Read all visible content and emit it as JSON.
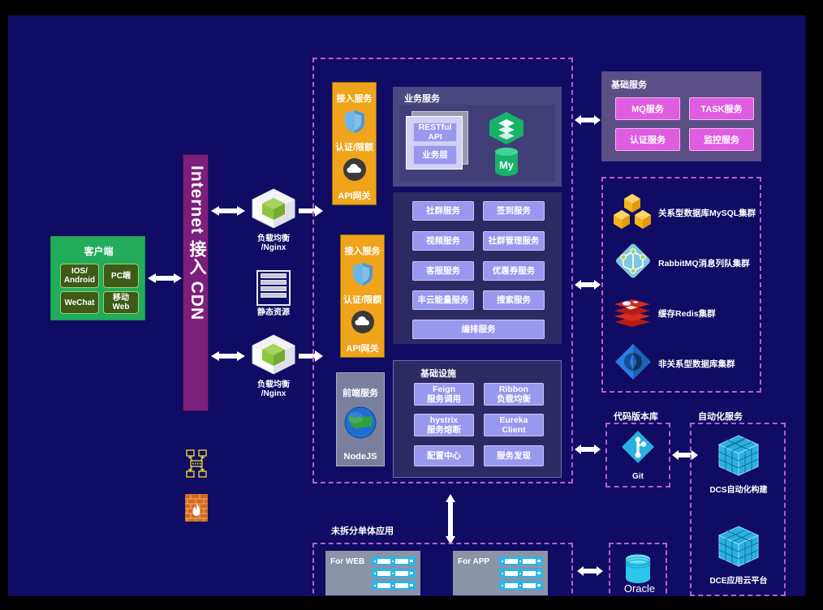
{
  "diagram": {
    "title": "Microservice Architecture Diagram",
    "background": "#100b63",
    "accent_dashed": "#b55fd0"
  },
  "client": {
    "title": "客户端",
    "chips": [
      "IOS/\nAndroid",
      "PC端",
      "WeChat",
      "移动\nWeb"
    ],
    "chip_ios": "IOS/",
    "chip_android": "Android",
    "chip_pc": "PC端",
    "chip_wechat": "WeChat",
    "chip_mweb1": "移动",
    "chip_mweb2": "Web"
  },
  "cdn": {
    "label": "Internet 接入 CDN",
    "network_icon": "network-topology-icon",
    "firewall_icon": "firewall-icon"
  },
  "edge": {
    "lb_top": {
      "line1": "负载均衡",
      "line2": "/Nginx",
      "icon": "cube-icon"
    },
    "lb_bottom": {
      "line1": "负载均衡",
      "line2": "/Nginx",
      "icon": "cube-icon"
    },
    "static": {
      "label": "静态资源",
      "icon": "static-resource-icon"
    }
  },
  "access_top": {
    "title": "接入服务",
    "auth_label": "认证/限额",
    "gateway_label": "API网关",
    "shield_icon": "shield-icon",
    "cloud_icon": "cloud-icon"
  },
  "access_bottom": {
    "title": "接入服务",
    "auth_label": "认证/限额",
    "gateway_label": "API网关",
    "shield_icon": "shield-icon",
    "cloud_icon": "cloud-icon"
  },
  "frontend": {
    "title": "前端服务",
    "name": "NodeJS",
    "icon": "globe-icon"
  },
  "business": {
    "title": "业务服务",
    "stack": {
      "restful": "RESTful\nAPI",
      "restful_l1": "RESTful",
      "restful_l2": "API",
      "biz_layer": "业务层"
    },
    "icons": {
      "layers": "layers-hexagon-icon",
      "mysql": "mysql-icon",
      "mysql_text": "My"
    },
    "services": [
      "社群服务",
      "签到服务",
      "视频服务",
      "社群管理服务",
      "客服服务",
      "优惠券服务",
      "丰云能量服务",
      "搜索服务"
    ],
    "service_wide": "编排服务"
  },
  "infra": {
    "title": "基础设施",
    "items": [
      {
        "l1": "Feign",
        "l2": "服务调用"
      },
      {
        "l1": "Ribbon",
        "l2": "负载均衡"
      },
      {
        "l1": "hystrix",
        "l2": "服务熔断"
      },
      {
        "l1": "Eureka",
        "l2": "Client"
      },
      {
        "l1": "配置中心",
        "l2": ""
      },
      {
        "l1": "服务发现",
        "l2": ""
      }
    ]
  },
  "basic_services": {
    "title": "基础服务",
    "items": [
      "MQ服务",
      "TASK服务",
      "认证服务",
      "监控服务"
    ]
  },
  "datastores": {
    "items": [
      {
        "label": "关系型数据库MySQL集群",
        "icon": "aws-cubes-icon",
        "color": "#f5b51a"
      },
      {
        "label": "RabbitMQ消息列队集群",
        "icon": "rabbitmq-diamond-icon",
        "color": "#6cc4e0"
      },
      {
        "label": "缓存Redis集群",
        "icon": "redis-stack-icon",
        "color": "#d42b22"
      },
      {
        "label": "非关系型数据库集群",
        "icon": "nosql-diamond-icon",
        "color": "#2a7de1"
      }
    ]
  },
  "vcs": {
    "title": "代码版本库",
    "name": "Git",
    "icon": "git-icon"
  },
  "automation": {
    "title": "自动化服务",
    "items": [
      {
        "label": "DCS自动化构建",
        "icon": "rubik-cube-icon"
      },
      {
        "label": "DCE应用云平台",
        "icon": "rubik-cube-icon"
      }
    ]
  },
  "oracle": {
    "label": "Oracle",
    "icon": "database-cylinder-icon"
  },
  "monolith": {
    "title": "未拆分单体应用",
    "groups": [
      {
        "label": "For WEB"
      },
      {
        "label": "For APP"
      }
    ]
  },
  "arrows": {
    "client_cdn": "bidirectional-arrow",
    "cdn_lb_top": "bidirectional-arrow",
    "cdn_lb_bottom": "bidirectional-arrow",
    "lb_gateway_top": "right-arrow",
    "lb_gateway_bottom": "right-arrow",
    "biz_basic": "bidirectional-arrow",
    "biz_data": "bidirectional-arrow",
    "biz_vcs": "bidirectional-arrow",
    "vcs_automation": "bidirectional-arrow",
    "biz_monolith": "bidirectional-vertical-arrow",
    "monolith_oracle": "bidirectional-arrow"
  }
}
